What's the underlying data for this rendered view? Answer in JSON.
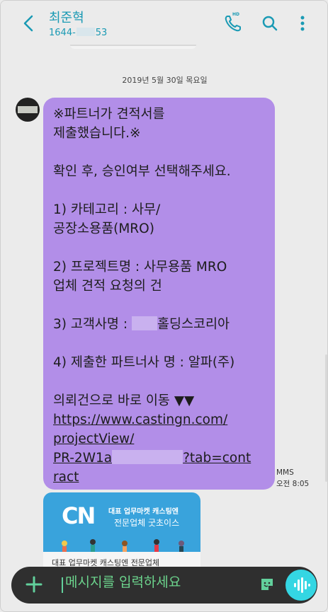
{
  "header": {
    "contact_name": "최준혁",
    "contact_number_prefix": "1644-",
    "contact_number_suffix": "53",
    "hd_badge": "HD"
  },
  "date_divider": "2019년 5월 30일 목요일",
  "message": {
    "line1": "※파트너가 견적서를",
    "line2": "제출했습니다.※",
    "line3": "확인 후, 승인여부 선택해주세요.",
    "line4": "1) 카테고리 : 사무/",
    "line5": "공장소용품(MRO)",
    "line6": "2) 프로젝트명 : 사무용품 MRO",
    "line7": "업체 견적 요청의 건",
    "line8_prefix": "3) 고객사명 : ",
    "line8_suffix": "홀딩스코리아",
    "line9": "4) 제출한 파트너사 명 : 알파(주)",
    "line10": "의뢰건으로 바로 이동 ▼▼",
    "link1": "https://www.castingn.com/",
    "link2": "projectView/",
    "link3_prefix": "PR-2W1a",
    "link3_suffix": "?tab=cont",
    "link4": "ract",
    "type_label": "MMS",
    "time": "오전 8:05"
  },
  "preview": {
    "logo": "CN",
    "brand_line1": "대표 업무마켓 캐스팅엔",
    "brand_line2": "전문업체 굿초이스",
    "caption": "대표 업무마켓 캐스팅엔 전문업체"
  },
  "composer": {
    "placeholder": "메시지를 입력하세요"
  },
  "colors": {
    "accent": "#1a9ab4",
    "bubble": "#b28ee8",
    "composer_bg": "#2f2f2f",
    "composer_text": "#6cd58d",
    "voice_button": "#34d6e3"
  }
}
